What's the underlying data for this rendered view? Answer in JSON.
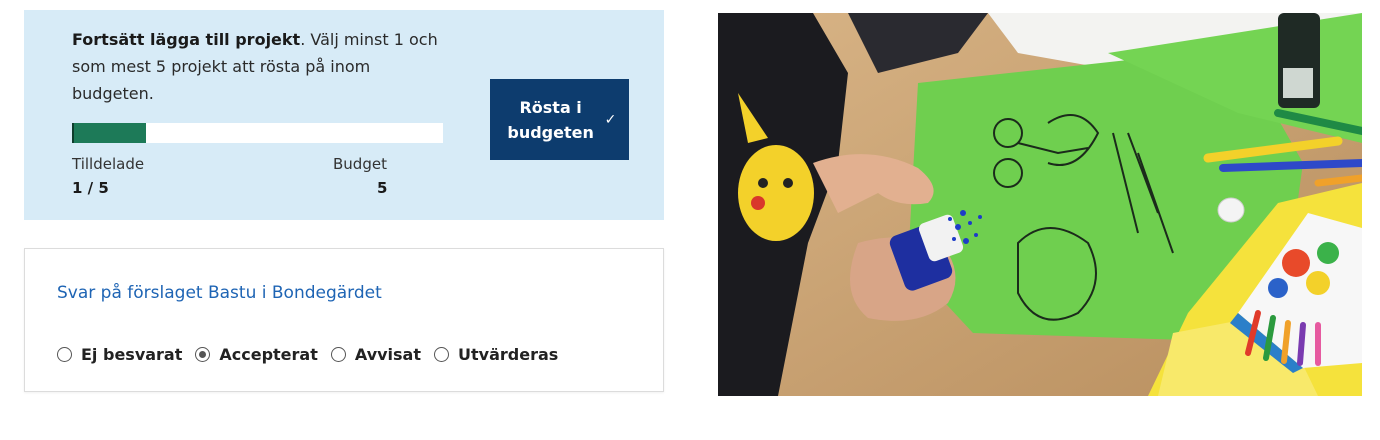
{
  "voting": {
    "intro_bold": "Fortsätt lägga till projekt",
    "intro_rest": ". Välj minst 1 och som mest 5 projekt att rösta på inom budgeten.",
    "progress_fraction": 0.2,
    "allocated_label": "Tilldelade",
    "allocated_value": "1 / 5",
    "budget_label": "Budget",
    "budget_value": "5",
    "vote_button_label": "Rösta i budgeten",
    "vote_button_icon": "check-icon",
    "colors": {
      "panel_bg": "#d7ebf7",
      "progress": "#1d7a58",
      "button": "#0d3c6e"
    }
  },
  "answer": {
    "title": "Svar på förslaget Bastu i Bondegärdet",
    "options": [
      {
        "label": "Ej besvarat",
        "checked": false
      },
      {
        "label": "Accepterat",
        "checked": true
      },
      {
        "label": "Avvisat",
        "checked": false
      },
      {
        "label": "Utvärderas",
        "checked": false
      }
    ],
    "title_color": "#1e64b4"
  }
}
